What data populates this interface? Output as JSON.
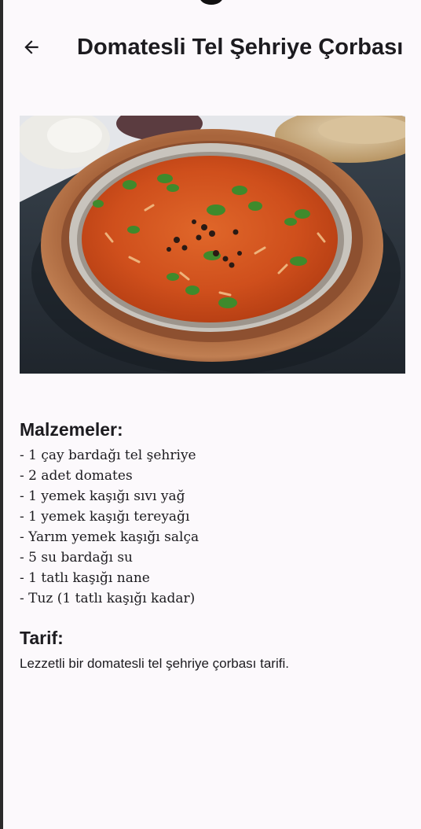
{
  "app_bar": {
    "title": "Domatesli Tel Şehriye Çorbası",
    "back_icon": "arrow-back-icon"
  },
  "hero_image": {
    "subject": "tomato vermicelli soup in copper bowl"
  },
  "ingredients": {
    "heading": "Malzemeler:",
    "items": [
      "- 1 çay bardağı tel şehriye",
      "- 2 adet domates",
      "- 1 yemek kaşığı sıvı yağ",
      "- 1 yemek kaşığı tereyağı",
      "- Yarım yemek kaşığı salça",
      "- 5 su bardağı su",
      "- 1 tatlı kaşığı nane",
      "- Tuz (1 tatlı kaşığı kadar)"
    ]
  },
  "recipe": {
    "heading": "Tarif:",
    "description": "Lezzetli bir domatesli tel şehriye çorbası tarifi."
  },
  "colors": {
    "background": "#fcf9fc",
    "text": "#1c1b1f",
    "soup": "#d4561f"
  }
}
